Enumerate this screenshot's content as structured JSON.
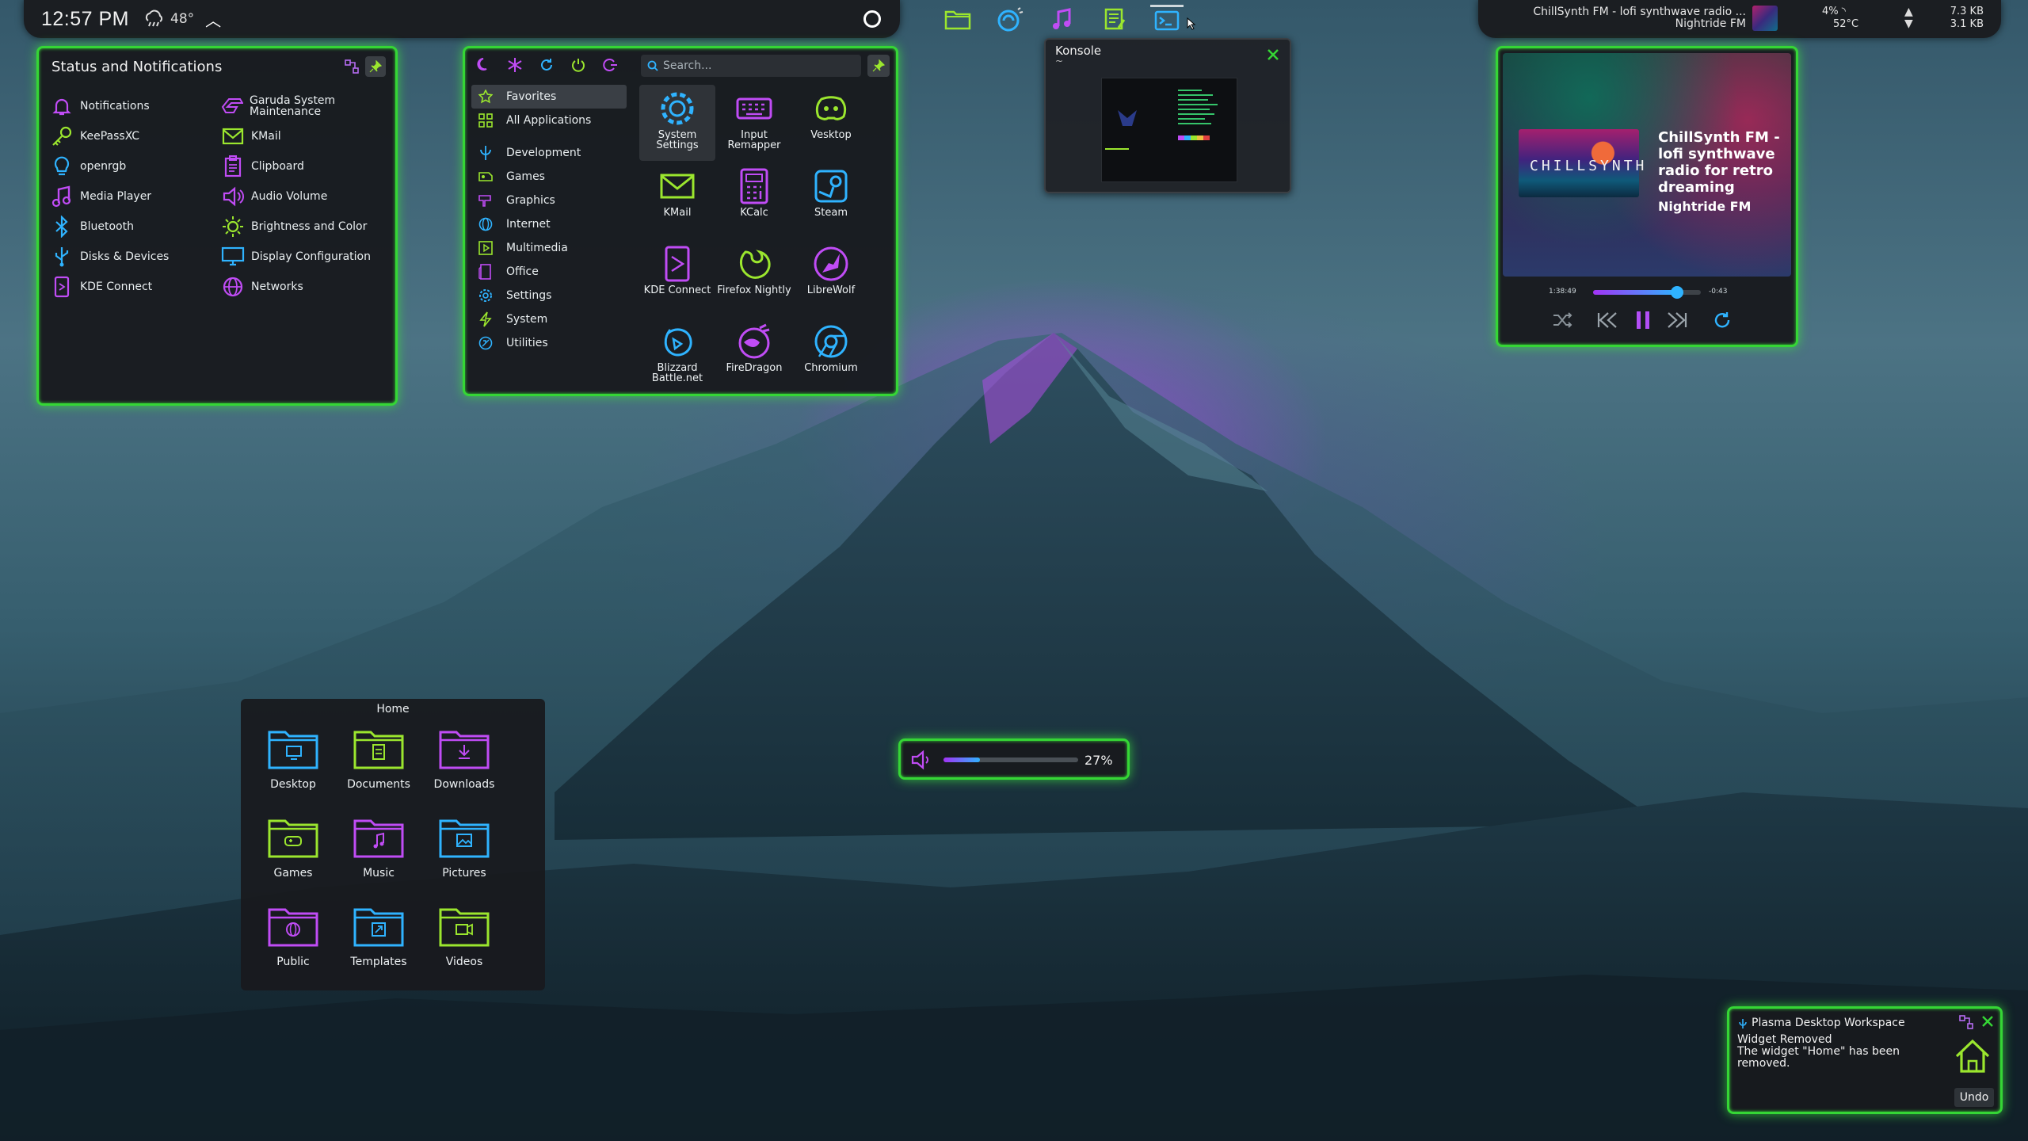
{
  "colors": {
    "accent_green": "#35d635",
    "accent_purple": "#a233f5",
    "accent_blue": "#2fb3ff",
    "accent_lime": "#9be62e"
  },
  "panel": {
    "clock": "12:57 PM",
    "weather_temp": "48°",
    "now_playing_title": "ChillSynth FM - lofi synthwave radio ...",
    "now_playing_artist": "Nightride FM",
    "cpu": "4%",
    "temp": "52°C",
    "net_up": "7.3 KB",
    "net_down": "3.1 KB",
    "task_icons": [
      "folder-icon",
      "firedragon-icon",
      "music-note-icon",
      "notes-icon",
      "terminal-icon"
    ]
  },
  "status": {
    "title": "Status and Notifications",
    "left": [
      {
        "label": "Notifications",
        "icon": "bell-icon"
      },
      {
        "label": "KeePassXC",
        "icon": "key-icon"
      },
      {
        "label": "openrgb",
        "icon": "bulb-icon"
      },
      {
        "label": "Media Player",
        "icon": "music-note-icon"
      },
      {
        "label": "Bluetooth",
        "icon": "bluetooth-icon"
      },
      {
        "label": "Disks & Devices",
        "icon": "usb-icon"
      },
      {
        "label": "KDE Connect",
        "icon": "phone-icon"
      }
    ],
    "right": [
      {
        "label": "Garuda System Maintenance",
        "icon": "garuda-icon"
      },
      {
        "label": "KMail",
        "icon": "mail-icon"
      },
      {
        "label": "Clipboard",
        "icon": "clipboard-icon"
      },
      {
        "label": "Audio Volume",
        "icon": "speaker-icon"
      },
      {
        "label": "Brightness and Color",
        "icon": "sun-icon"
      },
      {
        "label": "Display Configuration",
        "icon": "monitor-icon"
      },
      {
        "label": "Networks",
        "icon": "globe-icon"
      }
    ]
  },
  "launcher": {
    "search_placeholder": "Search...",
    "categories": [
      {
        "label": "Favorites",
        "icon": "star-icon"
      },
      {
        "label": "All Applications",
        "icon": "grid-icon"
      },
      {
        "label": "Development",
        "icon": "dev-icon"
      },
      {
        "label": "Games",
        "icon": "gamepad-icon"
      },
      {
        "label": "Graphics",
        "icon": "brush-icon"
      },
      {
        "label": "Internet",
        "icon": "globe-icon"
      },
      {
        "label": "Multimedia",
        "icon": "play-icon"
      },
      {
        "label": "Office",
        "icon": "office-icon"
      },
      {
        "label": "Settings",
        "icon": "gear-icon"
      },
      {
        "label": "System",
        "icon": "bolt-icon"
      },
      {
        "label": "Utilities",
        "icon": "tools-icon"
      }
    ],
    "apps": [
      {
        "label": "System Settings",
        "icon": "gear-icon",
        "color": "#2fb3ff"
      },
      {
        "label": "Input Remapper",
        "icon": "keyboard-icon",
        "color": "#c04cf5"
      },
      {
        "label": "Vesktop",
        "icon": "discord-icon",
        "color": "#9be62e"
      },
      {
        "label": "KMail",
        "icon": "mail-icon",
        "color": "#9be62e"
      },
      {
        "label": "KCalc",
        "icon": "calculator-icon",
        "color": "#c04cf5"
      },
      {
        "label": "Steam",
        "icon": "steam-icon",
        "color": "#2fb3ff"
      },
      {
        "label": "KDE Connect",
        "icon": "phone-icon",
        "color": "#c04cf5"
      },
      {
        "label": "Firefox Nightly",
        "icon": "firefox-icon",
        "color": "#9be62e"
      },
      {
        "label": "LibreWolf",
        "icon": "wolf-icon",
        "color": "#c04cf5"
      },
      {
        "label": "Blizzard Battle.net",
        "icon": "battlenet-icon",
        "color": "#2fb3ff"
      },
      {
        "label": "FireDragon",
        "icon": "dragon-icon",
        "color": "#c04cf5"
      },
      {
        "label": "Chromium",
        "icon": "chromium-icon",
        "color": "#2fb3ff"
      }
    ]
  },
  "konsole": {
    "title": "Konsole",
    "subtitle": "~"
  },
  "media": {
    "album_text": "CHILLSYNTH",
    "title": "ChillSynth FM - lofi synthwave radio for retro dreaming",
    "artist": "Nightride FM",
    "elapsed": "1:38:49",
    "remaining": "-0:43",
    "progress": 0.78
  },
  "home": {
    "title": "Home",
    "folders": [
      {
        "label": "Desktop",
        "color": "#2fb3ff",
        "icon": "desktop-folder-icon"
      },
      {
        "label": "Documents",
        "color": "#9be62e",
        "icon": "documents-folder-icon"
      },
      {
        "label": "Downloads",
        "color": "#c04cf5",
        "icon": "downloads-folder-icon"
      },
      {
        "label": "Games",
        "color": "#9be62e",
        "icon": "games-folder-icon"
      },
      {
        "label": "Music",
        "color": "#c04cf5",
        "icon": "music-folder-icon"
      },
      {
        "label": "Pictures",
        "color": "#2fb3ff",
        "icon": "pictures-folder-icon"
      },
      {
        "label": "Public",
        "color": "#c04cf5",
        "icon": "public-folder-icon"
      },
      {
        "label": "Templates",
        "color": "#2fb3ff",
        "icon": "templates-folder-icon"
      },
      {
        "label": "Videos",
        "color": "#9be62e",
        "icon": "videos-folder-icon"
      }
    ]
  },
  "osd": {
    "value_text": "27%",
    "level": 0.27
  },
  "notification": {
    "source": "Plasma Desktop Workspace",
    "heading": "Widget Removed",
    "body": "The widget \"Home\" has been removed.",
    "undo_label": "Undo"
  }
}
